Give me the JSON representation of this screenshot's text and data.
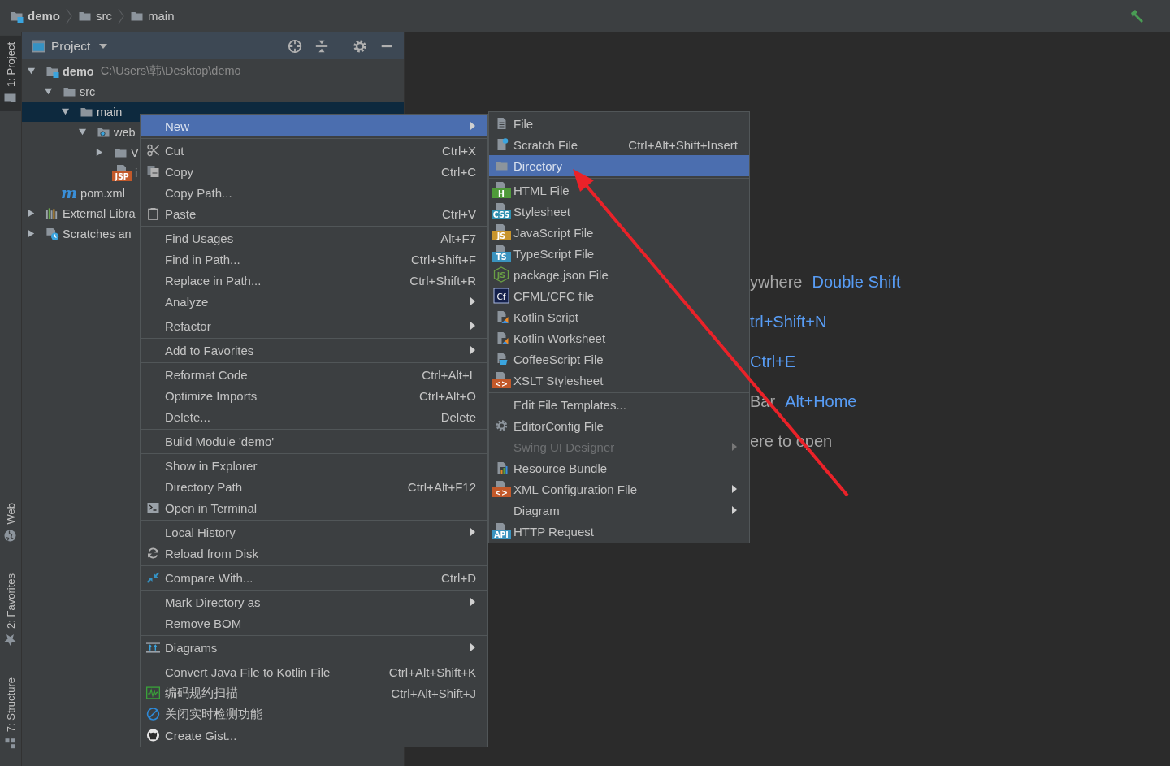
{
  "breadcrumbs": [
    {
      "label": "demo"
    },
    {
      "label": "src"
    },
    {
      "label": "main"
    }
  ],
  "toolbar": {
    "build_icon": true
  },
  "tool_stripe": {
    "top": [
      {
        "label": "1: Project",
        "selected": true
      }
    ],
    "bottom": [
      {
        "label": "Web",
        "selected": false
      },
      {
        "label": "2: Favorites",
        "selected": false
      },
      {
        "label": "7: Structure",
        "selected": false
      }
    ]
  },
  "project_panel": {
    "title": "Project",
    "tree": [
      {
        "label": "demo",
        "kind": "module",
        "path": "C:\\Users\\韩\\Desktop\\demo",
        "expanded": true,
        "selected": false,
        "children": [
          {
            "label": "src",
            "kind": "folder",
            "expanded": true,
            "selected": false,
            "children": [
              {
                "label": "main",
                "kind": "folder",
                "expanded": true,
                "selected": true,
                "children": [
                  {
                    "label": "web",
                    "kind": "webfolder",
                    "expanded": true,
                    "selected": false,
                    "children": [
                      {
                        "label": "V",
                        "kind": "folder",
                        "expanded": false,
                        "selected": false
                      },
                      {
                        "label": "i",
                        "kind": "badged",
                        "badge": "JSP",
                        "color": "#c2592a",
                        "selected": false
                      }
                    ]
                  }
                ]
              }
            ]
          },
          {
            "label": "pom.xml",
            "kind": "letter",
            "glyph": "m",
            "selected": false
          }
        ]
      },
      {
        "label": "External Libra",
        "kind": "library",
        "expanded": false,
        "selected": false
      },
      {
        "label": "Scratches an",
        "kind": "scratches",
        "expanded": false,
        "selected": false
      }
    ]
  },
  "editor_hints": [
    {
      "text": "ywhere",
      "shortcut": "Double Shift"
    },
    {
      "shortcut": "trl+Shift+N"
    },
    {
      "shortcut": "Ctrl+E"
    },
    {
      "text": "Bar",
      "shortcut": "Alt+Home"
    },
    {
      "text": "ere to open"
    }
  ],
  "context_menu": {
    "groups": [
      [
        {
          "label": "New",
          "kind": "text",
          "arrow": true,
          "selected": true
        }
      ],
      [
        {
          "label": "Cut",
          "shortcut": "Ctrl+X",
          "kind": "scissors",
          "selected": false
        },
        {
          "label": "Copy",
          "shortcut": "Ctrl+C",
          "kind": "copy",
          "selected": false
        },
        {
          "label": "Copy Path...",
          "kind": "text",
          "selected": false
        },
        {
          "label": "Paste",
          "shortcut": "Ctrl+V",
          "kind": "paste",
          "selected": false
        }
      ],
      [
        {
          "label": "Find Usages",
          "shortcut": "Alt+F7",
          "kind": "text",
          "selected": false
        },
        {
          "label": "Find in Path...",
          "shortcut": "Ctrl+Shift+F",
          "kind": "text",
          "selected": false
        },
        {
          "label": "Replace in Path...",
          "shortcut": "Ctrl+Shift+R",
          "kind": "text",
          "selected": false
        },
        {
          "label": "Analyze",
          "kind": "text",
          "arrow": true,
          "selected": false
        }
      ],
      [
        {
          "label": "Refactor",
          "kind": "text",
          "arrow": true,
          "selected": false
        }
      ],
      [
        {
          "label": "Add to Favorites",
          "kind": "text",
          "arrow": true,
          "selected": false
        }
      ],
      [
        {
          "label": "Reformat Code",
          "shortcut": "Ctrl+Alt+L",
          "kind": "text",
          "selected": false
        },
        {
          "label": "Optimize Imports",
          "shortcut": "Ctrl+Alt+O",
          "kind": "text",
          "selected": false
        },
        {
          "label": "Delete...",
          "shortcut": "Delete",
          "kind": "text",
          "selected": false
        }
      ],
      [
        {
          "label": "Build Module 'demo'",
          "kind": "text",
          "selected": false
        }
      ],
      [
        {
          "label": "Show in Explorer",
          "kind": "text",
          "selected": false
        },
        {
          "label": "Directory Path",
          "shortcut": "Ctrl+Alt+F12",
          "kind": "text",
          "selected": false
        },
        {
          "label": "Open in Terminal",
          "kind": "terminal",
          "selected": false
        }
      ],
      [
        {
          "label": "Local History",
          "kind": "text",
          "arrow": true,
          "selected": false
        },
        {
          "label": "Reload from Disk",
          "kind": "reload",
          "selected": false
        }
      ],
      [
        {
          "label": "Compare With...",
          "shortcut": "Ctrl+D",
          "kind": "compare",
          "selected": false
        }
      ],
      [
        {
          "label": "Mark Directory as",
          "kind": "text",
          "arrow": true,
          "selected": false
        },
        {
          "label": "Remove BOM",
          "kind": "text",
          "selected": false
        }
      ],
      [
        {
          "label": "Diagrams",
          "arrow": true,
          "kind": "diagram",
          "selected": false
        }
      ],
      [
        {
          "label": "Convert Java File to Kotlin File",
          "shortcut": "Ctrl+Alt+Shift+K",
          "kind": "text",
          "selected": false
        },
        {
          "label": "编码规约扫描",
          "shortcut": "Ctrl+Alt+Shift+J",
          "kind": "scan",
          "selected": false
        },
        {
          "label": "关闭实时检测功能",
          "kind": "nosign",
          "selected": false
        },
        {
          "label": "Create Gist...",
          "kind": "gist",
          "selected": false
        }
      ]
    ]
  },
  "submenu": {
    "groups": [
      [
        {
          "label": "File",
          "kind": "file",
          "selected": false,
          "disabled": false
        },
        {
          "label": "Scratch File",
          "shortcut": "Ctrl+Alt+Shift+Insert",
          "kind": "scratch",
          "selected": false,
          "disabled": false
        },
        {
          "label": "Directory",
          "kind": "folder",
          "selected": true,
          "disabled": false
        }
      ],
      [
        {
          "label": "HTML File",
          "kind": "badged",
          "badge": "H",
          "color": "#4f9a3a",
          "selected": false,
          "disabled": false
        },
        {
          "label": "Stylesheet",
          "kind": "badged",
          "badge": "CSS",
          "color": "#2f8fb0",
          "selected": false,
          "disabled": false
        },
        {
          "label": "JavaScript File",
          "kind": "badged",
          "badge": "JS",
          "color": "#c9952c",
          "selected": false,
          "disabled": false
        },
        {
          "label": "TypeScript File",
          "kind": "badged",
          "badge": "TS",
          "color": "#3a93bf",
          "selected": false,
          "disabled": false
        },
        {
          "label": "package.json File",
          "kind": "node",
          "badge": "JS",
          "selected": false,
          "disabled": false
        },
        {
          "label": "CFML/CFC file",
          "kind": "cfml",
          "badge": "Cf",
          "selected": false,
          "disabled": false
        },
        {
          "label": "Kotlin Script",
          "kind": "kotlin",
          "selected": false,
          "disabled": false
        },
        {
          "label": "Kotlin Worksheet",
          "kind": "kotlin",
          "selected": false,
          "disabled": false
        },
        {
          "label": "CoffeeScript File",
          "kind": "coffee",
          "selected": false,
          "disabled": false
        },
        {
          "label": "XSLT Stylesheet",
          "kind": "badged",
          "badge": "<>",
          "color": "#c2592a",
          "selected": false,
          "disabled": false
        }
      ],
      [
        {
          "label": "Edit File Templates...",
          "kind": "text",
          "selected": false,
          "disabled": false
        },
        {
          "label": "EditorConfig File",
          "kind": "gear",
          "selected": false,
          "disabled": false
        },
        {
          "label": "Swing UI Designer",
          "kind": "text",
          "arrow": true,
          "selected": false,
          "disabled": true
        },
        {
          "label": "Resource Bundle",
          "kind": "bundle",
          "selected": false,
          "disabled": false
        },
        {
          "label": "XML Configuration File",
          "arrow": true,
          "kind": "badged",
          "badge": "<>",
          "color": "#c2592a",
          "selected": false,
          "disabled": false
        },
        {
          "label": "Diagram",
          "kind": "text",
          "arrow": true,
          "selected": false,
          "disabled": false
        },
        {
          "label": "HTTP Request",
          "kind": "badged",
          "badge": "API",
          "color": "#3a93bf",
          "selected": false,
          "disabled": false
        }
      ]
    ]
  },
  "annotation": {
    "kind": "arrow"
  }
}
